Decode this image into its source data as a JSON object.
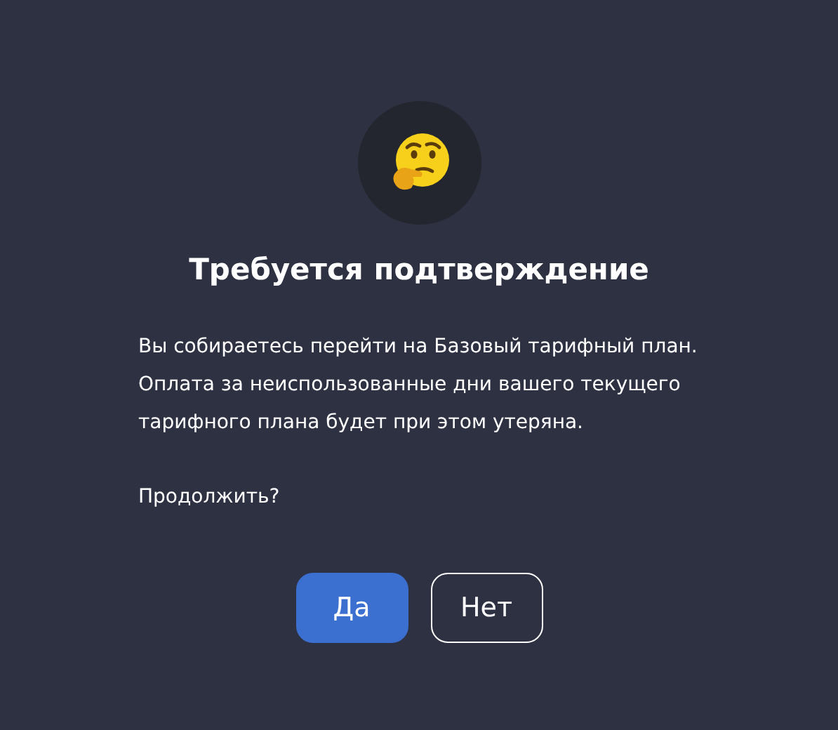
{
  "dialog": {
    "title": "Требуется подтверждение",
    "message": "Вы собираетесь перейти на Базовый тарифный план. Оплата за неиспользованные дни вашего текущего тарифного плана будет при этом утеряна.",
    "question": "Продолжить?",
    "buttons": [
      {
        "label": "Да",
        "kind": "primary"
      },
      {
        "label": "Нет",
        "kind": "secondary"
      }
    ]
  }
}
